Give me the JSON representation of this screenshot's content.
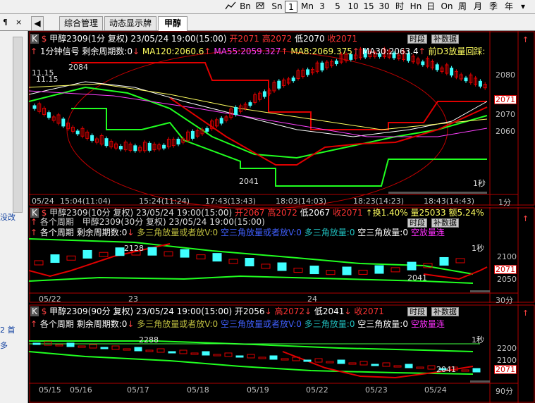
{
  "toolbar": {
    "periods": [
      "Bn",
      "Sn",
      "1",
      "Mn",
      "3",
      "5",
      "10",
      "15",
      "30",
      "时",
      "Hn",
      "日",
      "On",
      "周",
      "月",
      "季",
      "年"
    ],
    "active": "1"
  },
  "tabs": {
    "prefix": "¶",
    "items": [
      "综合管理",
      "动态显示牌",
      "甲醇"
    ],
    "active": "甲醇"
  },
  "left": {
    "text1": "没改",
    "text2": "2 首",
    "text3": "多"
  },
  "panel1": {
    "title": "甲醇2309(1分 复权) 23/05/24 19:00(15:00)",
    "open": "开2071",
    "high": "高2072",
    "low": "低2070",
    "close": "收2071",
    "btn_time": "时段",
    "btn_fill": "补数据",
    "line2a": "1分钟信号 剩余周期数:0",
    "ma120": "MA120:2060.6",
    "ma55": "MA55:2059.327",
    "ma8": "MA8:2069.375",
    "ma30": "MA30:2063.4",
    "tail": "前D3放量回踩:",
    "hi_label": "2084",
    "lo_label": "2041",
    "left_a": "11.15",
    "left_b": "11.15",
    "sec_label": "1秒",
    "price_box": "2071",
    "yticks": [
      "2080",
      "2070",
      "2060"
    ],
    "xlabels": [
      "05/24",
      "15:04(11:04)",
      "15:24(11:24)",
      "17:43(13:43)",
      "18:03(14:03)",
      "18:23(14:23)",
      "18:43(14:43)",
      "1分"
    ],
    "colors": {
      "up": "#ff2020",
      "down": "#00ffff",
      "ma": "#ffff80",
      "green": "#20ff20"
    }
  },
  "panel2": {
    "title": "甲醇2309(30分 复权) 23/05/24 19:00(15:00)",
    "title_b": "甲醇2309(10分 复权) 23/05/24 19:00(15:00)",
    "open": "开2067",
    "high": "高2072",
    "low": "低2067",
    "close": "收2071",
    "extra": "↑换1.40% 量25033 额5.24%",
    "line2": "各个周期 剩余周期数:0",
    "tri1": "多三角放量或者放V:0",
    "tri2": "空三角放量或者放V:0",
    "tri3": "多三角放量:0",
    "tri4": "空三角放量:0",
    "tri5": "空放量连",
    "sub": "各个周期",
    "hi_label": "2128",
    "lo_label": "2041",
    "sec_label": "1秒",
    "price_box": "2071",
    "yticks": [
      "2100",
      "2050"
    ],
    "xlabels": [
      "05/22",
      "23",
      "24",
      "30分"
    ],
    "btn_time": "时段",
    "btn_fill": "补数据"
  },
  "panel3": {
    "title": "甲醇2309(90分 复权) 23/05/24 19:00(15:00)",
    "open": "开2056",
    "high": "高2072",
    "low": "低2041",
    "close": "收2071",
    "line2": "各个周期 剩余周期数:0",
    "tri1": "多三角放量或者放V:0",
    "tri2": "空三角放量或者放V:0",
    "tri3": "多三角放量:0",
    "tri4": "空三角放量:0",
    "tri5": "空放量连",
    "hi_label": "2288",
    "lo_label": "2041",
    "sec_label": "1秒",
    "price_box": "2071",
    "yticks": [
      "2200",
      "2100"
    ],
    "xlabels": [
      "05/15",
      "05/16",
      "05/17",
      "05/18",
      "05/19",
      "05/22",
      "05/23",
      "05/24",
      "90分"
    ],
    "btn_time": "时段",
    "btn_fill": "补数据"
  }
}
